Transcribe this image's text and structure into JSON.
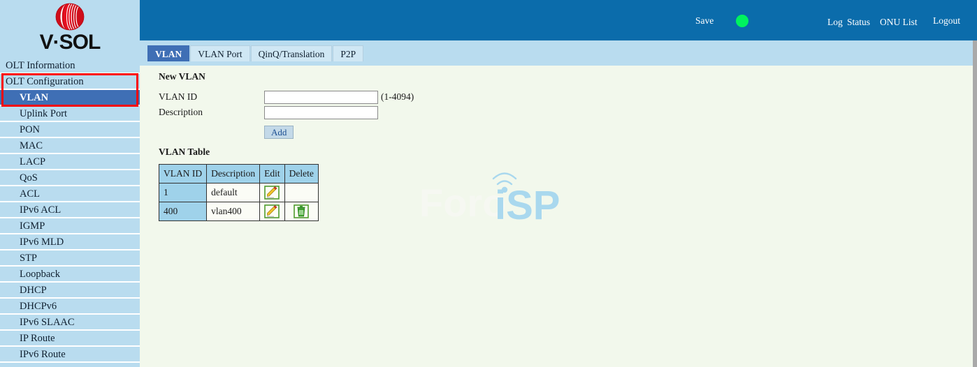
{
  "sidebar": {
    "logo_alt": "V-SOL",
    "logo_text": "V·SOL",
    "items": [
      {
        "label": "OLT Information",
        "level": "top",
        "active": false
      },
      {
        "label": "OLT Configuration",
        "level": "top",
        "active": false
      },
      {
        "label": "VLAN",
        "level": "sub",
        "active": true
      },
      {
        "label": "Uplink Port",
        "level": "sub",
        "active": false
      },
      {
        "label": "PON",
        "level": "sub",
        "active": false
      },
      {
        "label": "MAC",
        "level": "sub",
        "active": false
      },
      {
        "label": "LACP",
        "level": "sub",
        "active": false
      },
      {
        "label": "QoS",
        "level": "sub",
        "active": false
      },
      {
        "label": "ACL",
        "level": "sub",
        "active": false
      },
      {
        "label": "IPv6 ACL",
        "level": "sub",
        "active": false
      },
      {
        "label": "IGMP",
        "level": "sub",
        "active": false
      },
      {
        "label": "IPv6 MLD",
        "level": "sub",
        "active": false
      },
      {
        "label": "STP",
        "level": "sub",
        "active": false
      },
      {
        "label": "Loopback",
        "level": "sub",
        "active": false
      },
      {
        "label": "DHCP",
        "level": "sub",
        "active": false
      },
      {
        "label": "DHCPv6",
        "level": "sub",
        "active": false
      },
      {
        "label": "IPv6 SLAAC",
        "level": "sub",
        "active": false
      },
      {
        "label": "IP Route",
        "level": "sub",
        "active": false
      },
      {
        "label": "IPv6 Route",
        "level": "sub",
        "active": false
      }
    ],
    "highlight_color": "#fb0606"
  },
  "header": {
    "save_label": "Save",
    "status_dot": "status-indicator-green",
    "status_dot_color": "#00f25e",
    "log_label": "Log",
    "status_label": "Status",
    "onu_list_label": "ONU List",
    "logout_label": "Logout",
    "background_color": "#0b6cab"
  },
  "tabs": [
    {
      "label": "VLAN",
      "active": true
    },
    {
      "label": "VLAN Port",
      "active": false
    },
    {
      "label": "QinQ/Translation",
      "active": false
    },
    {
      "label": "P2P",
      "active": false
    }
  ],
  "new_vlan": {
    "section_title": "New VLAN",
    "vlan_id_label": "VLAN ID",
    "vlan_id_value": "",
    "vlan_id_placeholder": "",
    "vlan_id_hint": "(1-4094)",
    "description_label": "Description",
    "description_value": "",
    "description_placeholder": "",
    "add_label": "Add"
  },
  "vlan_table": {
    "title": "VLAN Table",
    "columns": [
      "VLAN ID",
      "Description",
      "Edit",
      "Delete"
    ],
    "rows": [
      {
        "vlan_id": "1",
        "description": "default",
        "edit_icon": "edit-pencil-icon",
        "delete_icon": null
      },
      {
        "vlan_id": "400",
        "description": "vlan400",
        "edit_icon": "edit-pencil-icon",
        "delete_icon": "delete-trash-icon"
      }
    ]
  },
  "watermark": {
    "text_left": "Foro",
    "text_right": "iSP",
    "color_left": "#f6f8f2",
    "color_right": "#a9d8ee"
  }
}
